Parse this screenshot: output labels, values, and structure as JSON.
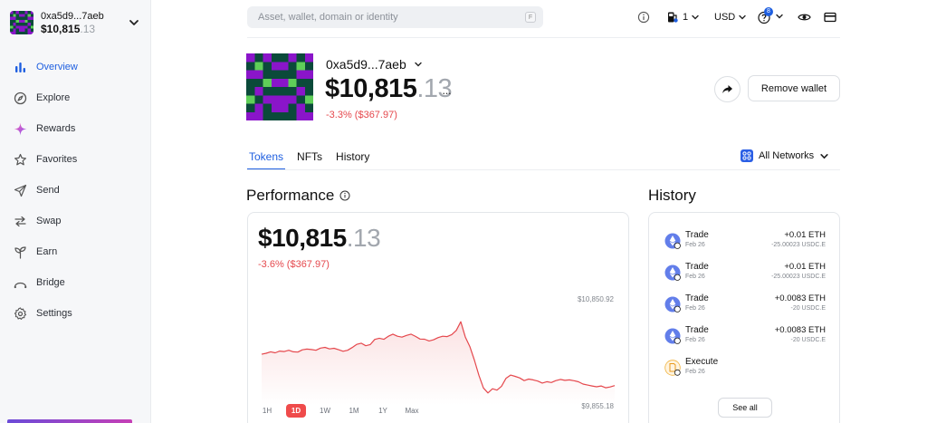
{
  "account": {
    "address": "0xa5d9...7aeb",
    "balance_main": "$10,815",
    "balance_cents": ".13"
  },
  "nav": {
    "items": [
      {
        "label": "Overview",
        "icon": "bar-chart-icon"
      },
      {
        "label": "Explore",
        "icon": "compass-icon"
      },
      {
        "label": "Rewards",
        "icon": "sparkle-icon"
      },
      {
        "label": "Favorites",
        "icon": "star-icon"
      },
      {
        "label": "Send",
        "icon": "send-icon"
      },
      {
        "label": "Swap",
        "icon": "swap-icon"
      },
      {
        "label": "Earn",
        "icon": "sprout-icon"
      },
      {
        "label": "Bridge",
        "icon": "bridge-icon"
      },
      {
        "label": "Settings",
        "icon": "gear-icon"
      }
    ]
  },
  "search": {
    "placeholder": "Asset, wallet, domain or identity",
    "shortcut": "F"
  },
  "topbar": {
    "gas_value": "1",
    "currency": "USD",
    "badge_count": "8"
  },
  "wallet": {
    "address": "0xa5d9...7aeb",
    "balance_main": "$10,815",
    "balance_cents": ".13",
    "more": "···",
    "change": "-3.3% ($367.97)",
    "remove_label": "Remove wallet"
  },
  "tabs": [
    "Tokens",
    "NFTs",
    "History"
  ],
  "networks": {
    "label": "All Networks"
  },
  "performance": {
    "title": "Performance",
    "balance_main": "$10,815",
    "balance_cents": ".13",
    "change": "-3.6% ($367.97)",
    "ranges": [
      "1H",
      "1D",
      "1W",
      "1M",
      "1Y",
      "Max"
    ],
    "active_range": "1D"
  },
  "chart_data": {
    "type": "area",
    "y_max_label": "$10,850.92",
    "y_min_label": "$9,855.18",
    "ylim": [
      9855.18,
      10850.92
    ],
    "color": "#e5484d",
    "values": [
      10320,
      10330,
      10345,
      10335,
      10352,
      10348,
      10360,
      10345,
      10342,
      10365,
      10372,
      10368,
      10360,
      10382,
      10390,
      10374,
      10380,
      10366,
      10350,
      10360,
      10388,
      10420,
      10432,
      10406,
      10418,
      10470,
      10482,
      10471,
      10502,
      10523,
      10502,
      10493,
      10510,
      10523,
      10500,
      10474,
      10472,
      10454,
      10466,
      10488,
      10502,
      10498,
      10518,
      10560,
      10648,
      10494,
      10398,
      10262,
      10108,
      9980,
      9930,
      9972,
      9958,
      9998,
      10078,
      10110,
      10097,
      10082,
      10054,
      10070,
      10062,
      10050,
      10030,
      10043,
      10035,
      10054,
      10066,
      10057,
      10062,
      10053,
      10042,
      10020,
      10010,
      10000,
      9992,
      10000,
      9982,
      9990,
      10004
    ]
  },
  "history": {
    "title": "History",
    "see_all": "See all",
    "items": [
      {
        "type": "Trade",
        "date": "Feb 26",
        "amount": "+0.01 ETH",
        "sub": "-25.00023 USDC.E",
        "icon": "eth-icon"
      },
      {
        "type": "Trade",
        "date": "Feb 26",
        "amount": "+0.01 ETH",
        "sub": "-25.00023 USDC.E",
        "icon": "eth-icon"
      },
      {
        "type": "Trade",
        "date": "Feb 26",
        "amount": "+0.0083 ETH",
        "sub": "-20 USDC.E",
        "icon": "eth-icon"
      },
      {
        "type": "Trade",
        "date": "Feb 26",
        "amount": "+0.0083 ETH",
        "sub": "-20 USDC.E",
        "icon": "eth-icon"
      },
      {
        "type": "Execute",
        "date": "Feb 26",
        "amount": "",
        "sub": "",
        "icon": "document-icon"
      }
    ]
  },
  "colors": {
    "accent": "#1f5fe0",
    "negative": "#e5484d",
    "avatar_dark": "#0b4a3a",
    "avatar_purple": "#8a15c9",
    "avatar_green": "#5fcf58"
  }
}
